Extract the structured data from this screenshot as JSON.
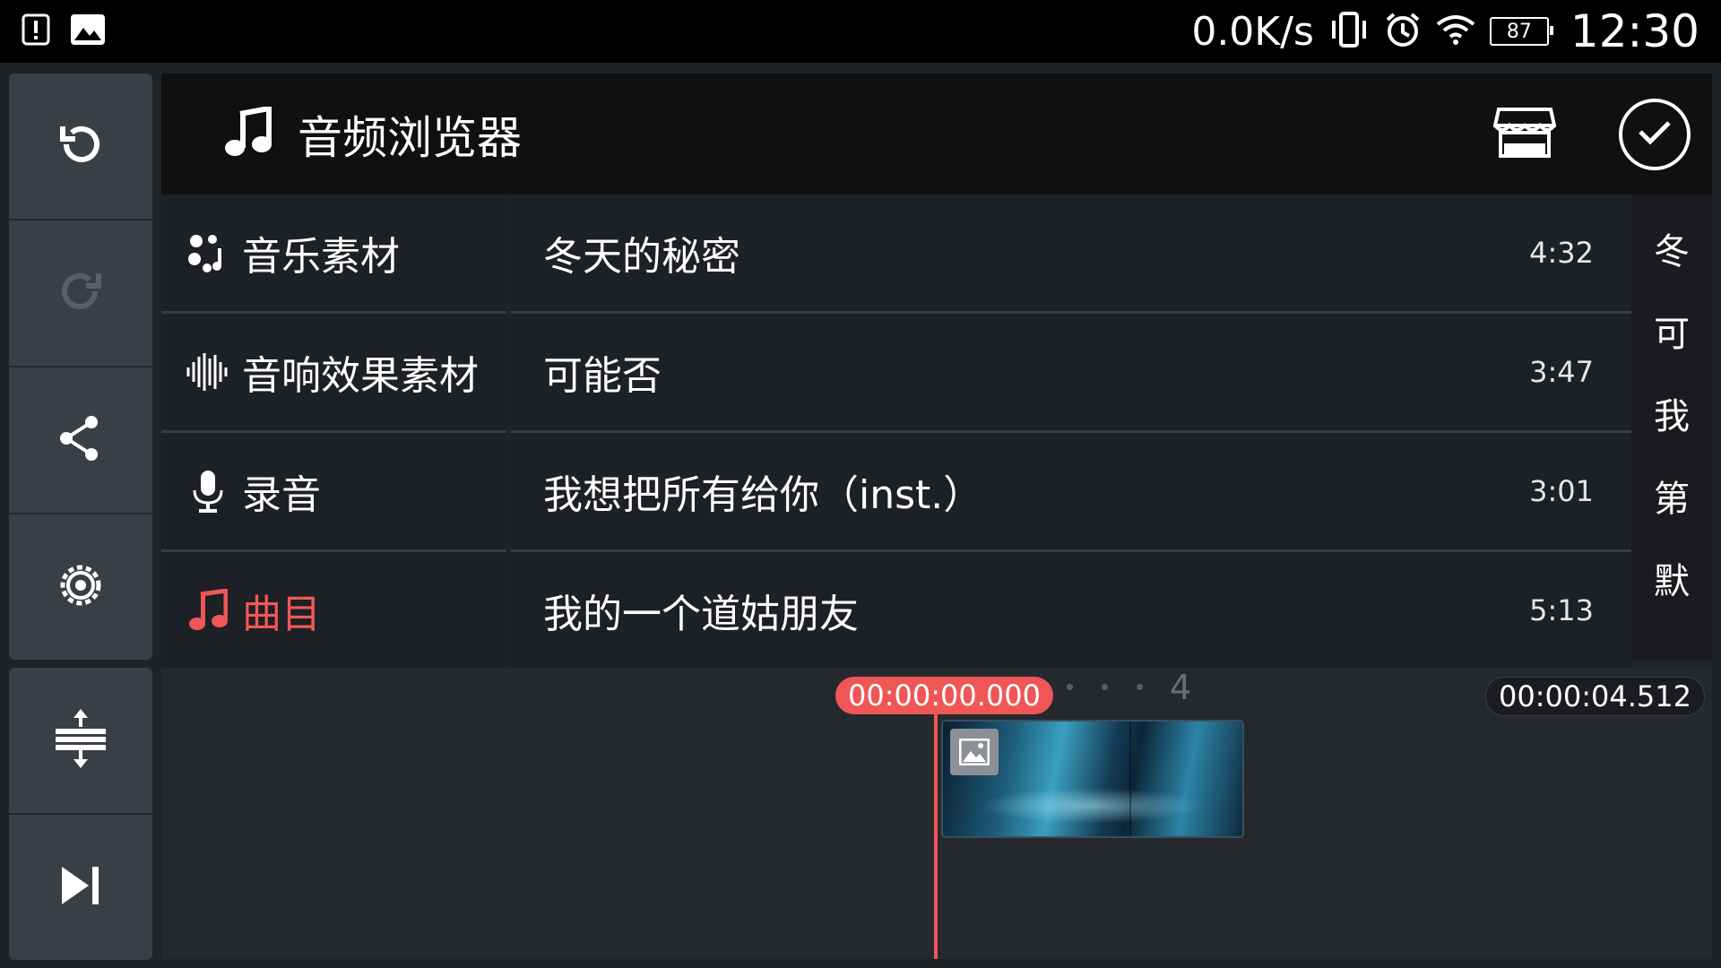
{
  "status_bar": {
    "net_speed": "0.0K/s",
    "battery": "87",
    "time": "12:30"
  },
  "left_toolbar": {
    "items": [
      "undo",
      "redo",
      "share",
      "settings"
    ],
    "bottom_items": [
      "expand-layers",
      "skip-to-end"
    ]
  },
  "header": {
    "title": "音频浏览器"
  },
  "categories": [
    {
      "label": "音乐素材",
      "active": false
    },
    {
      "label": "音响效果素材",
      "active": false
    },
    {
      "label": "录音",
      "active": false
    },
    {
      "label": "曲目",
      "active": true
    }
  ],
  "tracks": [
    {
      "name": "冬天的秘密",
      "duration": "4:32"
    },
    {
      "name": "可能否",
      "duration": "3:47"
    },
    {
      "name": "我想把所有给你（inst.）",
      "duration": "3:01"
    },
    {
      "name": "我的一个道姑朋友",
      "duration": "5:13"
    }
  ],
  "index_letters": [
    "冬",
    "可",
    "我",
    "第",
    "默"
  ],
  "timeline": {
    "current_time": "00:00:00.000",
    "total_time": "00:00:04.512",
    "ruler_mark": "4"
  },
  "colors": {
    "accent": "#ef5656",
    "background": "#1f2226",
    "header": "#0e1012",
    "toolbar": "#3a3f46"
  }
}
